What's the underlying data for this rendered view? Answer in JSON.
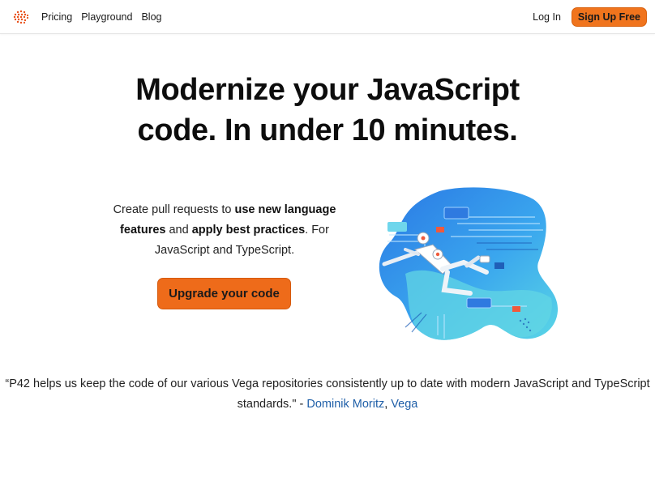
{
  "nav": {
    "logo_icon": "p42-logo-icon",
    "links": [
      "Pricing",
      "Playground",
      "Blog"
    ],
    "login": "Log In",
    "signup": "Sign Up Free"
  },
  "hero": {
    "title_line1": "Modernize your JavaScript",
    "title_line2": "code. In under 10 minutes.",
    "blurb": {
      "part1": "Create pull requests to ",
      "bold1": "use new language features",
      "part2": " and ",
      "bold2": "apply best practices",
      "part3": ". For JavaScript and TypeScript."
    },
    "cta": "Upgrade your code",
    "illustration_icon": "robot-illustration-icon"
  },
  "testimonial": {
    "text": "“P42 helps us keep the code of our various Vega repositories consistently up to date with modern JavaScript and TypeScript standards.\" - ",
    "author": "Dominik Moritz",
    "separator": ", ",
    "org": "Vega"
  },
  "colors": {
    "accent": "#f0741d",
    "link": "#1f5fa8",
    "illustration_blue": "#2f8ee8",
    "illustration_teal": "#4fd0e0"
  }
}
